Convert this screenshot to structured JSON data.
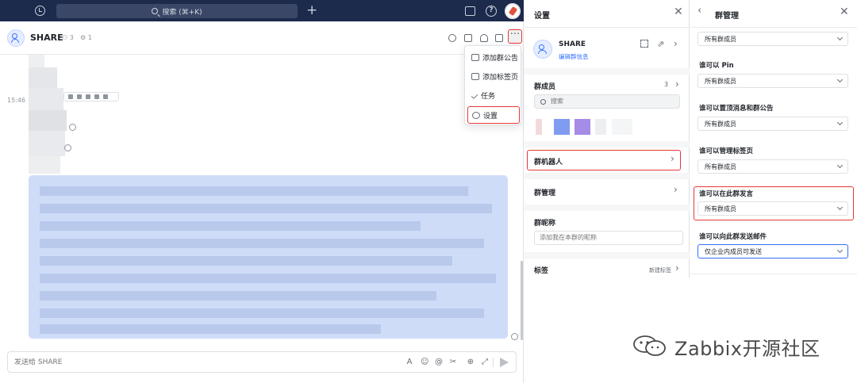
{
  "titlebar": {
    "search_placeholder": "搜索 (⌘+K)",
    "icons": [
      "history-icon",
      "search-icon",
      "plus-icon",
      "screenshot-icon",
      "help-icon",
      "avatar"
    ]
  },
  "chat": {
    "group_name": "SHARE",
    "member_count": "3",
    "bot_count": "1",
    "timestamp": "15:46",
    "composer_placeholder": "发送给 SHARE",
    "composer_icons": [
      "font-icon",
      "emoji-icon",
      "mention-icon",
      "scissors-icon",
      "plus-circle-icon",
      "expand-icon",
      "send-icon"
    ]
  },
  "dropdown": {
    "items": [
      {
        "label": "添加群公告",
        "icon": "announcement-icon"
      },
      {
        "label": "添加标签页",
        "icon": "tab-icon"
      },
      {
        "label": "任务",
        "icon": "task-icon"
      },
      {
        "label": "设置",
        "icon": "gear-icon"
      }
    ]
  },
  "settings": {
    "title": "设置",
    "group_name": "SHARE",
    "edit_link": "编辑群信息",
    "members_label": "群成员",
    "members_count": "3",
    "search_placeholder": "搜索",
    "bots_label": "群机器人",
    "management_label": "群管理",
    "nickname_label": "群昵称",
    "nickname_placeholder": "添加我在本群的昵称",
    "tags_label": "标签",
    "tags_new": "新建标签"
  },
  "management": {
    "title": "群管理",
    "rows": [
      {
        "label": "",
        "value": "所有群成员"
      },
      {
        "label": "谁可以 Pin",
        "value": "所有群成员"
      },
      {
        "label": "谁可以置顶消息和群公告",
        "value": "所有群成员"
      },
      {
        "label": "谁可以管理标签页",
        "value": "所有群成员"
      },
      {
        "label": "谁可以在此群发言",
        "value": "所有群成员"
      },
      {
        "label": "谁可以向此群发送邮件",
        "value": "仅企业内成员可发送"
      }
    ]
  },
  "watermark": {
    "text": "Zabbix开源社区"
  },
  "colors": {
    "titlebar": "#1c2a4c",
    "accent": "#3370ff",
    "highlight": "#e53935",
    "selected_message": "#cfdcf8"
  }
}
